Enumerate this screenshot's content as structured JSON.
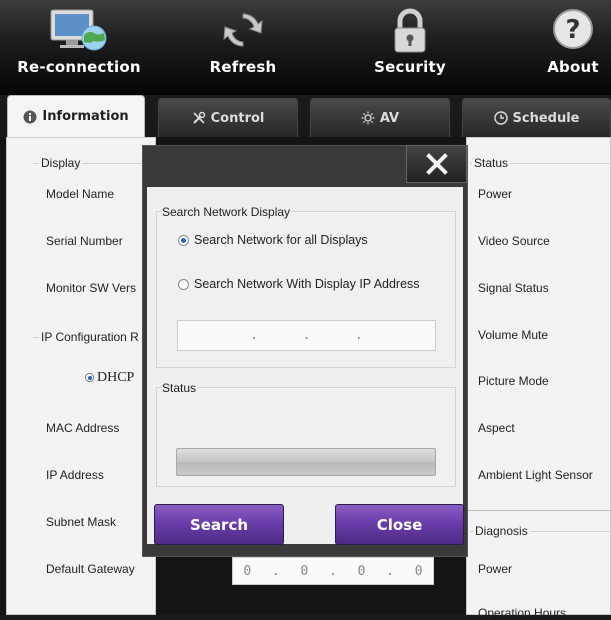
{
  "toolbar": {
    "reconnection": "Re-connection",
    "refresh": "Refresh",
    "security": "Security",
    "about": "About"
  },
  "tabs": [
    {
      "label": "Information",
      "active": true
    },
    {
      "label": "Control",
      "active": false
    },
    {
      "label": "AV",
      "active": false
    },
    {
      "label": "Schedule",
      "active": false
    }
  ],
  "left_panel": {
    "display_group": "Display",
    "model_name": "Model Name",
    "serial_number": "Serial Number",
    "monitor_sw": "Monitor SW Vers",
    "ip_group": "IP Configuration R",
    "dhcp": "DHCP",
    "mac_address": "MAC Address",
    "ip_address": "IP Address",
    "subnet_mask": "Subnet Mask",
    "default_gateway": "Default Gateway",
    "gateway_octets": [
      "0",
      "0",
      "0",
      "0"
    ]
  },
  "right_panel": {
    "status_group": "Status",
    "power": "Power",
    "video_source": "Video Source",
    "signal_status": "Signal Status",
    "volume_mute": "Volume Mute",
    "picture_mode": "Picture Mode",
    "aspect": "Aspect",
    "ambient_light": "Ambient Light Sensor",
    "diagnosis_group": "Diagnosis",
    "diag_power": "Power",
    "operation_hours": "Operation Hours"
  },
  "dialog": {
    "search_group": "Search Network Display",
    "option_all": "Search Network for all Displays",
    "option_ip": "Search Network With Display IP Address",
    "selected_option": "all",
    "status_group": "Status",
    "progress_percent": 0,
    "search_button": "Search",
    "close_button": "Close"
  },
  "colors": {
    "button_purple": "#6a3eaa",
    "radio_blue": "#2a62c9"
  }
}
